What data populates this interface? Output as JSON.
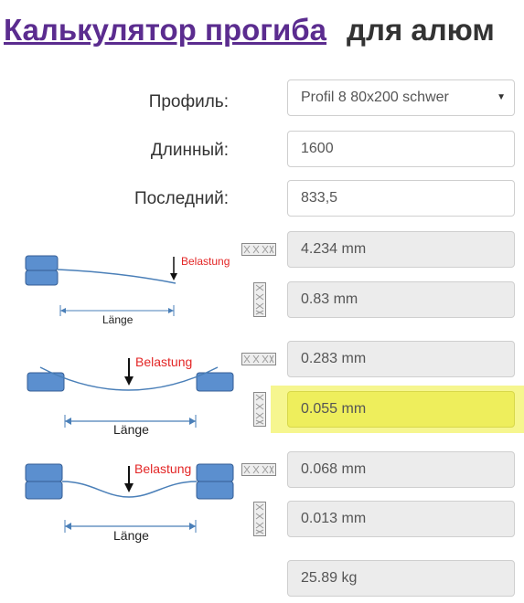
{
  "header": {
    "title_link": "Калькулятор прогиба",
    "title_rest": "для алюм"
  },
  "form": {
    "profile_label": "Профиль:",
    "profile_value": "Profil 8 80x200 schwer",
    "length_label": "Длинный:",
    "length_value": "1600",
    "load_label": "Последний:",
    "load_value": "833,5"
  },
  "diagrams": {
    "load_label": "Belastung",
    "length_label": "Länge"
  },
  "results": {
    "cantilever_horizontal": "4.234 mm",
    "cantilever_vertical": "0.83 mm",
    "simply_supported_horizontal": "0.283 mm",
    "simply_supported_vertical": "0.055 mm",
    "fixed_horizontal": "0.068 mm",
    "fixed_vertical": "0.013 mm",
    "weight": "25.89 kg"
  },
  "colors": {
    "title_link": "#5b2c8f",
    "highlight": "#eeee5c",
    "support_block": "#5b8fcf",
    "beam_line": "#4a7fb8",
    "load_text": "#e32626"
  },
  "icons": {
    "horizontal_profile": "profile-horizontal-icon",
    "vertical_profile": "profile-vertical-icon",
    "dropdown": "chevron-down-icon"
  }
}
